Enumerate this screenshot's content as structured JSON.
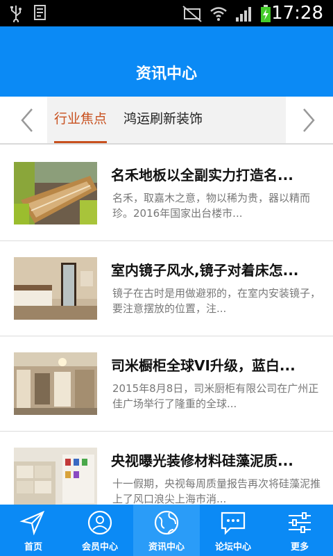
{
  "status_bar": {
    "time": "17:28"
  },
  "header": {
    "title": "资讯中心"
  },
  "tabs": [
    {
      "label": "行业焦点",
      "active": true
    },
    {
      "label": "鸿运刷新装饰",
      "active": false
    }
  ],
  "news": [
    {
      "title": "名禾地板以全副实力打造名...",
      "summary": "名禾，取嘉木之意，物以稀为贵，器以精而珍。2016年国家出台楼市...",
      "image": "wood-table-photo"
    },
    {
      "title": "室内镜子风水,镜子对着床怎...",
      "summary": "镜子在古时是用做避邪的，在室内安装镜子，要注意摆放的位置，注...",
      "image": "bedroom-mirror-photo"
    },
    {
      "title": "司米橱柜全球VI升级，蓝白...",
      "summary": "2015年8月8日，司米厨柜有限公司在广州正佳广场举行了隆重的全球...",
      "image": "showroom-photo"
    },
    {
      "title": "央视曝光装修材料硅藻泥质...",
      "summary": "十一假期，央视每周质量报告再次将硅藻泥推上了风口浪尖上海市消...",
      "image": "material-bags-photo"
    }
  ],
  "bottom_nav": [
    {
      "label": "首页",
      "icon": "send-icon",
      "active": false
    },
    {
      "label": "会员中心",
      "icon": "user-icon",
      "active": false
    },
    {
      "label": "资讯中心",
      "icon": "globe-icon",
      "active": true
    },
    {
      "label": "论坛中心",
      "icon": "chat-icon",
      "active": false
    },
    {
      "label": "更多",
      "icon": "sliders-icon",
      "active": false
    }
  ],
  "colors": {
    "primary": "#0b8af5",
    "active_tab": "#c8501e",
    "summary_text": "#777777"
  }
}
